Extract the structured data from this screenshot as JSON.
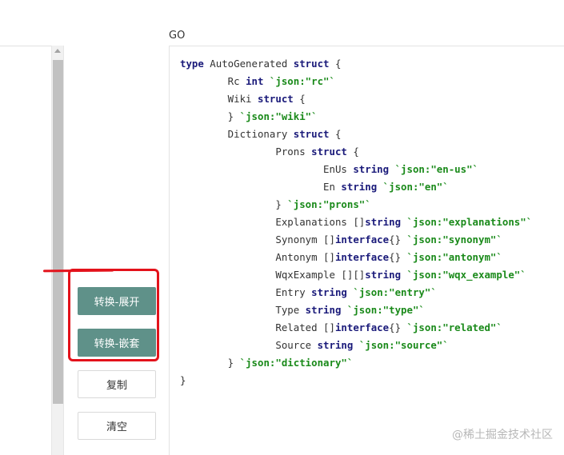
{
  "code_panel": {
    "language_label": "GO",
    "lines": [
      [
        {
          "t": "type",
          "c": "kw"
        },
        {
          "t": " AutoGenerated "
        },
        {
          "t": "struct",
          "c": "kw"
        },
        {
          "t": " {"
        }
      ],
      [
        {
          "t": "        Rc "
        },
        {
          "t": "int",
          "c": "kw"
        },
        {
          "t": " "
        },
        {
          "t": "`json:\"rc\"`",
          "c": "tag"
        }
      ],
      [
        {
          "t": "        Wiki "
        },
        {
          "t": "struct",
          "c": "kw"
        },
        {
          "t": " {"
        }
      ],
      [
        {
          "t": "        } "
        },
        {
          "t": "`json:\"wiki\"`",
          "c": "tag"
        }
      ],
      [
        {
          "t": "        Dictionary "
        },
        {
          "t": "struct",
          "c": "kw"
        },
        {
          "t": " {"
        }
      ],
      [
        {
          "t": "                Prons "
        },
        {
          "t": "struct",
          "c": "kw"
        },
        {
          "t": " {"
        }
      ],
      [
        {
          "t": "                        EnUs "
        },
        {
          "t": "string",
          "c": "kw"
        },
        {
          "t": " "
        },
        {
          "t": "`json:\"en-us\"`",
          "c": "tag"
        }
      ],
      [
        {
          "t": "                        En "
        },
        {
          "t": "string",
          "c": "kw"
        },
        {
          "t": " "
        },
        {
          "t": "`json:\"en\"`",
          "c": "tag"
        }
      ],
      [
        {
          "t": "                } "
        },
        {
          "t": "`json:\"prons\"`",
          "c": "tag"
        }
      ],
      [
        {
          "t": "                Explanations []"
        },
        {
          "t": "string",
          "c": "kw"
        },
        {
          "t": " "
        },
        {
          "t": "`json:\"explanations\"`",
          "c": "tag"
        }
      ],
      [
        {
          "t": "                Synonym []"
        },
        {
          "t": "interface",
          "c": "kw"
        },
        {
          "t": "{} "
        },
        {
          "t": "`json:\"synonym\"`",
          "c": "tag"
        }
      ],
      [
        {
          "t": "                Antonym []"
        },
        {
          "t": "interface",
          "c": "kw"
        },
        {
          "t": "{} "
        },
        {
          "t": "`json:\"antonym\"`",
          "c": "tag"
        }
      ],
      [
        {
          "t": "                WqxExample [][]"
        },
        {
          "t": "string",
          "c": "kw"
        },
        {
          "t": " "
        },
        {
          "t": "`json:\"wqx_example\"`",
          "c": "tag"
        }
      ],
      [
        {
          "t": "                Entry "
        },
        {
          "t": "string",
          "c": "kw"
        },
        {
          "t": " "
        },
        {
          "t": "`json:\"entry\"`",
          "c": "tag"
        }
      ],
      [
        {
          "t": "                Type "
        },
        {
          "t": "string",
          "c": "kw"
        },
        {
          "t": " "
        },
        {
          "t": "`json:\"type\"`",
          "c": "tag"
        }
      ],
      [
        {
          "t": "                Related []"
        },
        {
          "t": "interface",
          "c": "kw"
        },
        {
          "t": "{} "
        },
        {
          "t": "`json:\"related\"`",
          "c": "tag"
        }
      ],
      [
        {
          "t": "                Source "
        },
        {
          "t": "string",
          "c": "kw"
        },
        {
          "t": " "
        },
        {
          "t": "`json:\"source\"`",
          "c": "tag"
        }
      ],
      [
        {
          "t": "        } "
        },
        {
          "t": "`json:\"dictionary\"`",
          "c": "tag"
        }
      ],
      [
        {
          "t": "}"
        }
      ]
    ]
  },
  "actions": {
    "convert_expand": "转换-展开",
    "convert_nested": "转换-嵌套",
    "copy": "复制",
    "clear": "清空"
  },
  "watermark": "@稀土掘金技术社区",
  "colors": {
    "primary_button": "#5f9189",
    "keyword": "#1a1a7a",
    "json_tag": "#1a8a1a",
    "annotation": "#e3121b"
  }
}
